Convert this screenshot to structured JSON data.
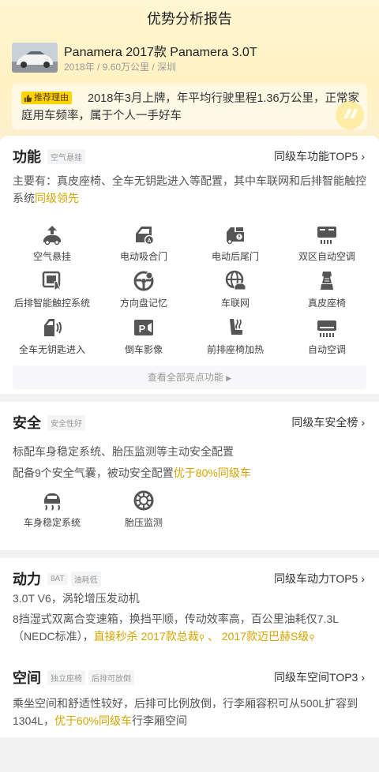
{
  "header": {
    "title": "优势分析报告"
  },
  "car": {
    "name": "Panamera 2017款 Panamera 3.0T",
    "meta": "2018年 / 9.60万公里 / 深圳"
  },
  "reason": {
    "badge": "推荐理由",
    "text": "2018年3月上牌，年平均行驶里程1.36万公里，正常家庭用车频率，属于个人一手好车"
  },
  "features": {
    "title": "功能",
    "tag": "空气悬挂",
    "link": "同级车功能TOP5",
    "desc_prefix": "主要有：真皮座椅、全车无钥匙进入等配置，其中车联网和后排智能触控系统",
    "desc_highlight": "同级领先",
    "items": [
      {
        "icon": "air-suspension-icon",
        "label": "空气悬挂"
      },
      {
        "icon": "electric-door-icon",
        "label": "电动吸合门"
      },
      {
        "icon": "electric-tailgate-icon",
        "label": "电动后尾门"
      },
      {
        "icon": "dual-zone-ac-icon",
        "label": "双区自动空调"
      },
      {
        "icon": "rear-touch-control-icon",
        "label": "后排智能触控系统"
      },
      {
        "icon": "steering-memory-icon",
        "label": "方向盘记忆"
      },
      {
        "icon": "connected-car-icon",
        "label": "车联网"
      },
      {
        "icon": "leather-seat-icon",
        "label": "真皮座椅"
      },
      {
        "icon": "keyless-entry-icon",
        "label": "全车无钥匙进入"
      },
      {
        "icon": "reverse-camera-icon",
        "label": "倒车影像"
      },
      {
        "icon": "seat-heating-icon",
        "label": "前排座椅加热"
      },
      {
        "icon": "auto-ac-icon",
        "label": "自动空调"
      }
    ],
    "more": "查看全部亮点功能"
  },
  "safety": {
    "title": "安全",
    "tag": "安全性好",
    "link": "同级车安全榜",
    "line1": "标配车身稳定系统、胎压监测等主动安全配置",
    "line2_prefix": "配备9个安全气囊，被动安全配置",
    "line2_highlight": "优于80%同级车",
    "items": [
      {
        "icon": "stability-control-icon",
        "label": "车身稳定系统"
      },
      {
        "icon": "tire-pressure-icon",
        "label": "胎压监测"
      }
    ]
  },
  "power": {
    "title": "动力",
    "tags": [
      "8AT",
      "油耗低"
    ],
    "link": "同级车动力TOP5",
    "line1": "3.0T V6，涡轮增压发动机",
    "line2": "8挡湿式双离合变速箱，换挡平顺，传动效率高，百公里油耗仅7.3L（NEDC标准），",
    "line2_hl": "直接秒杀",
    "compare1": "2017款总裁",
    "sep": "、",
    "compare2": "2017款迈巴赫S级"
  },
  "space": {
    "title": "空间",
    "tags": [
      "独立座椅",
      "后排可放倒"
    ],
    "link": "同级车空间TOP3",
    "text_prefix": "乘坐空间和舒适性较好，后排可比例放倒，行李厢容积可从500L扩容到1304L，",
    "text_highlight": "优于60%同级车",
    "text_suffix": "行李厢空间"
  }
}
